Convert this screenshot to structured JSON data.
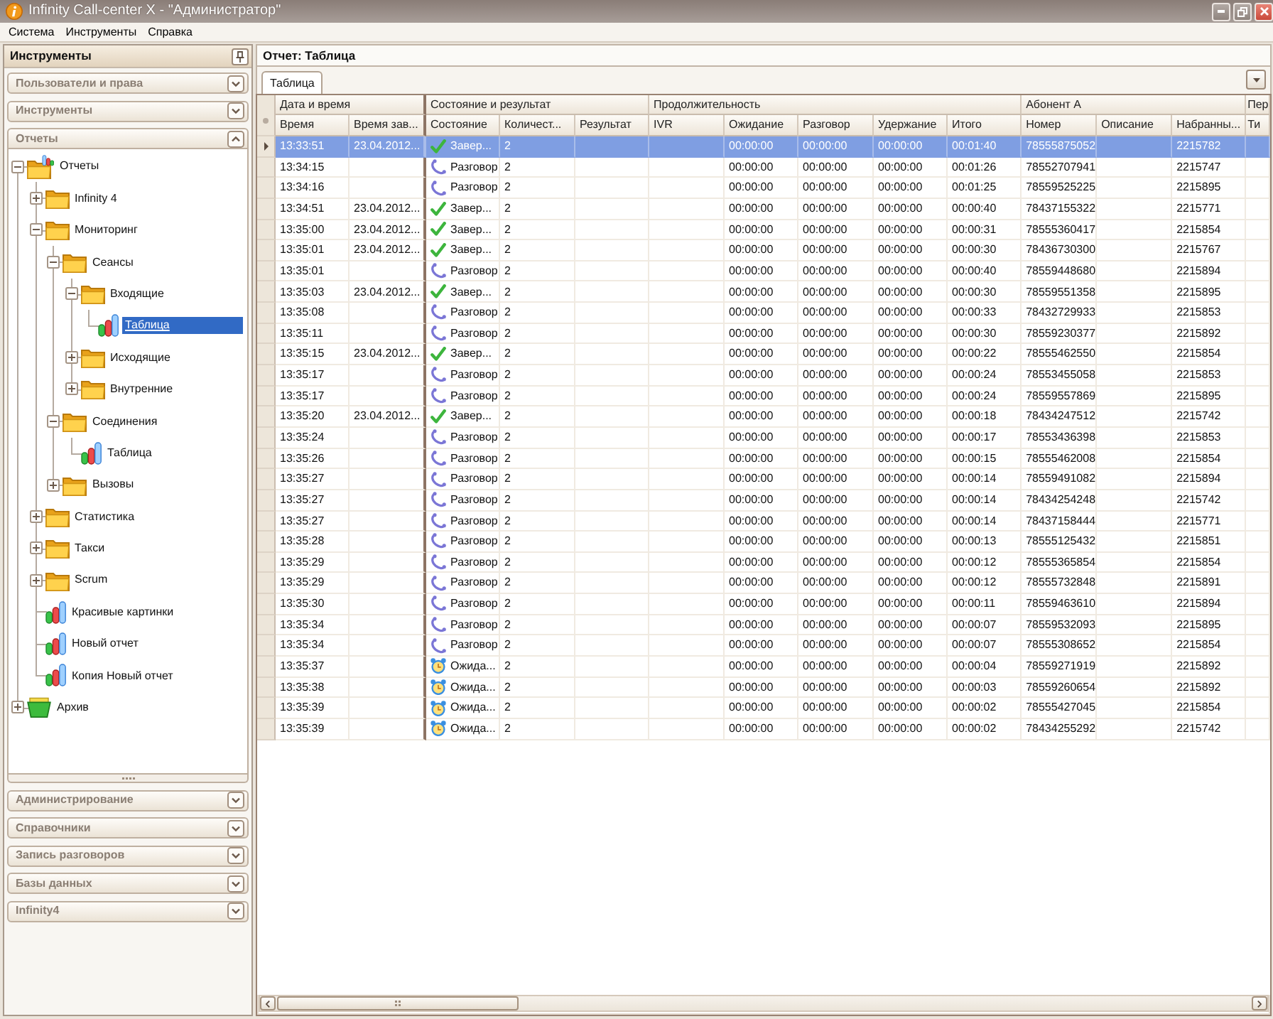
{
  "window": {
    "title": "Infinity Call-center X - \"Администратор\""
  },
  "menu": [
    "Система",
    "Инструменты",
    "Справка"
  ],
  "sidebar": {
    "title": "Инструменты",
    "sections": [
      {
        "title": "Пользователи и права",
        "expanded": false
      },
      {
        "title": "Инструменты",
        "expanded": false
      },
      {
        "title": "Отчеты",
        "expanded": true,
        "tree": [
          {
            "label": "Отчеты",
            "kind": "collection",
            "expanded": true,
            "selected": false,
            "children": [
              {
                "label": "Infinity 4",
                "kind": "folder",
                "expanded": false,
                "selected": false
              },
              {
                "label": "Мониторинг",
                "kind": "folder",
                "expanded": true,
                "selected": false,
                "children": [
                  {
                    "label": "Сеансы",
                    "kind": "folder",
                    "expanded": true,
                    "selected": false,
                    "children": [
                      {
                        "label": "Входящие",
                        "kind": "folder",
                        "expanded": true,
                        "selected": false,
                        "children": [
                          {
                            "label": "Таблица",
                            "kind": "report",
                            "selected": true
                          }
                        ]
                      },
                      {
                        "label": "Исходящие",
                        "kind": "folder",
                        "expanded": false,
                        "selected": false
                      },
                      {
                        "label": "Внутренние",
                        "kind": "folder",
                        "expanded": false,
                        "selected": false
                      }
                    ]
                  },
                  {
                    "label": "Соединения",
                    "kind": "folder",
                    "expanded": true,
                    "selected": false,
                    "children": [
                      {
                        "label": "Таблица",
                        "kind": "report",
                        "selected": false
                      }
                    ]
                  },
                  {
                    "label": "Вызовы",
                    "kind": "folder",
                    "expanded": false,
                    "selected": false
                  }
                ]
              },
              {
                "label": "Статистика",
                "kind": "folder",
                "expanded": false,
                "selected": false
              },
              {
                "label": "Такси",
                "kind": "folder",
                "expanded": false,
                "selected": false
              },
              {
                "label": "Scrum",
                "kind": "folder",
                "expanded": false,
                "selected": false
              },
              {
                "label": "Красивые картинки",
                "kind": "report",
                "selected": false
              },
              {
                "label": "Новый отчет",
                "kind": "report",
                "selected": false
              },
              {
                "label": "Копия Новый отчет",
                "kind": "report",
                "selected": false
              }
            ]
          },
          {
            "label": "Архив",
            "kind": "archive",
            "expanded": false,
            "selected": false
          }
        ]
      },
      {
        "title": "Администрирование",
        "expanded": false
      },
      {
        "title": "Справочники",
        "expanded": false
      },
      {
        "title": "Запись разговоров",
        "expanded": false
      },
      {
        "title": "Базы данных",
        "expanded": false
      },
      {
        "title": "Infinity4",
        "expanded": false
      }
    ]
  },
  "report": {
    "title": "Отчет: Таблица",
    "tabs": [
      {
        "label": "Таблица",
        "selected": true
      }
    ],
    "table": {
      "groups": [
        {
          "title": "Дата и время",
          "frozen": true,
          "columns": [
            "Время",
            "Время зав..."
          ]
        },
        {
          "title": "Состояние и результат",
          "frozen": false,
          "columns": [
            "Состояние",
            "Количест...",
            "Результат"
          ]
        },
        {
          "title": "Продолжительность",
          "frozen": false,
          "columns": [
            "IVR",
            "Ожидание",
            "Разговор",
            "Удержание",
            "Итого"
          ]
        },
        {
          "title": "Абонент А",
          "frozen": false,
          "columns": [
            "Номер",
            "Описание",
            "Набранны..."
          ]
        },
        {
          "title": "Пер",
          "frozen": false,
          "columns": [
            "Ти"
          ]
        }
      ],
      "rows": [
        {
          "selected": true,
          "time": "13:33:51",
          "end_time": "23.04.2012...",
          "state": {
            "kind": "done",
            "label": "Завер..."
          },
          "count": "2",
          "wait": "00:00:00",
          "talk": "00:00:00",
          "hold": "00:00:00",
          "total": "00:01:40",
          "number": "78555875052",
          "dialed": "2215782"
        },
        {
          "selected": false,
          "time": "13:34:15",
          "state": {
            "kind": "call",
            "label": "Разговор"
          },
          "count": "2",
          "wait": "00:00:00",
          "talk": "00:00:00",
          "hold": "00:00:00",
          "total": "00:01:26",
          "number": "78552707941",
          "dialed": "2215747"
        },
        {
          "selected": false,
          "time": "13:34:16",
          "state": {
            "kind": "call",
            "label": "Разговор"
          },
          "count": "2",
          "wait": "00:00:00",
          "talk": "00:00:00",
          "hold": "00:00:00",
          "total": "00:01:25",
          "number": "78559525225",
          "dialed": "2215895"
        },
        {
          "selected": false,
          "time": "13:34:51",
          "end_time": "23.04.2012...",
          "state": {
            "kind": "done",
            "label": "Завер..."
          },
          "count": "2",
          "wait": "00:00:00",
          "talk": "00:00:00",
          "hold": "00:00:00",
          "total": "00:00:40",
          "number": "78437155322",
          "dialed": "2215771"
        },
        {
          "selected": false,
          "time": "13:35:00",
          "end_time": "23.04.2012...",
          "state": {
            "kind": "done",
            "label": "Завер..."
          },
          "count": "2",
          "wait": "00:00:00",
          "talk": "00:00:00",
          "hold": "00:00:00",
          "total": "00:00:31",
          "number": "78555360417",
          "dialed": "2215854"
        },
        {
          "selected": false,
          "time": "13:35:01",
          "end_time": "23.04.2012...",
          "state": {
            "kind": "done",
            "label": "Завер..."
          },
          "count": "2",
          "wait": "00:00:00",
          "talk": "00:00:00",
          "hold": "00:00:00",
          "total": "00:00:30",
          "number": "78436730300",
          "dialed": "2215767"
        },
        {
          "selected": false,
          "time": "13:35:01",
          "state": {
            "kind": "call",
            "label": "Разговор"
          },
          "count": "2",
          "wait": "00:00:00",
          "talk": "00:00:00",
          "hold": "00:00:00",
          "total": "00:00:40",
          "number": "78559448680",
          "dialed": "2215894"
        },
        {
          "selected": false,
          "time": "13:35:03",
          "end_time": "23.04.2012...",
          "state": {
            "kind": "done",
            "label": "Завер..."
          },
          "count": "2",
          "wait": "00:00:00",
          "talk": "00:00:00",
          "hold": "00:00:00",
          "total": "00:00:30",
          "number": "78559551358",
          "dialed": "2215895"
        },
        {
          "selected": false,
          "time": "13:35:08",
          "state": {
            "kind": "call",
            "label": "Разговор"
          },
          "count": "2",
          "wait": "00:00:00",
          "talk": "00:00:00",
          "hold": "00:00:00",
          "total": "00:00:33",
          "number": "78432729933",
          "dialed": "2215853"
        },
        {
          "selected": false,
          "time": "13:35:11",
          "state": {
            "kind": "call",
            "label": "Разговор"
          },
          "count": "2",
          "wait": "00:00:00",
          "talk": "00:00:00",
          "hold": "00:00:00",
          "total": "00:00:30",
          "number": "78559230377",
          "dialed": "2215892"
        },
        {
          "selected": false,
          "time": "13:35:15",
          "end_time": "23.04.2012...",
          "state": {
            "kind": "done",
            "label": "Завер..."
          },
          "count": "2",
          "wait": "00:00:00",
          "talk": "00:00:00",
          "hold": "00:00:00",
          "total": "00:00:22",
          "number": "78555462550",
          "dialed": "2215854"
        },
        {
          "selected": false,
          "time": "13:35:17",
          "state": {
            "kind": "call",
            "label": "Разговор"
          },
          "count": "2",
          "wait": "00:00:00",
          "talk": "00:00:00",
          "hold": "00:00:00",
          "total": "00:00:24",
          "number": "78553455058",
          "dialed": "2215853"
        },
        {
          "selected": false,
          "time": "13:35:17",
          "state": {
            "kind": "call",
            "label": "Разговор"
          },
          "count": "2",
          "wait": "00:00:00",
          "talk": "00:00:00",
          "hold": "00:00:00",
          "total": "00:00:24",
          "number": "78559557869",
          "dialed": "2215895"
        },
        {
          "selected": false,
          "time": "13:35:20",
          "end_time": "23.04.2012...",
          "state": {
            "kind": "done",
            "label": "Завер..."
          },
          "count": "2",
          "wait": "00:00:00",
          "talk": "00:00:00",
          "hold": "00:00:00",
          "total": "00:00:18",
          "number": "78434247512",
          "dialed": "2215742"
        },
        {
          "selected": false,
          "time": "13:35:24",
          "state": {
            "kind": "call",
            "label": "Разговор"
          },
          "count": "2",
          "wait": "00:00:00",
          "talk": "00:00:00",
          "hold": "00:00:00",
          "total": "00:00:17",
          "number": "78553436398",
          "dialed": "2215853"
        },
        {
          "selected": false,
          "time": "13:35:26",
          "state": {
            "kind": "call",
            "label": "Разговор"
          },
          "count": "2",
          "wait": "00:00:00",
          "talk": "00:00:00",
          "hold": "00:00:00",
          "total": "00:00:15",
          "number": "78555462008",
          "dialed": "2215854"
        },
        {
          "selected": false,
          "time": "13:35:27",
          "state": {
            "kind": "call",
            "label": "Разговор"
          },
          "count": "2",
          "wait": "00:00:00",
          "talk": "00:00:00",
          "hold": "00:00:00",
          "total": "00:00:14",
          "number": "78559491082",
          "dialed": "2215894"
        },
        {
          "selected": false,
          "time": "13:35:27",
          "state": {
            "kind": "call",
            "label": "Разговор"
          },
          "count": "2",
          "wait": "00:00:00",
          "talk": "00:00:00",
          "hold": "00:00:00",
          "total": "00:00:14",
          "number": "78434254248",
          "dialed": "2215742"
        },
        {
          "selected": false,
          "time": "13:35:27",
          "state": {
            "kind": "call",
            "label": "Разговор"
          },
          "count": "2",
          "wait": "00:00:00",
          "talk": "00:00:00",
          "hold": "00:00:00",
          "total": "00:00:14",
          "number": "78437158444",
          "dialed": "2215771"
        },
        {
          "selected": false,
          "time": "13:35:28",
          "state": {
            "kind": "call",
            "label": "Разговор"
          },
          "count": "2",
          "wait": "00:00:00",
          "talk": "00:00:00",
          "hold": "00:00:00",
          "total": "00:00:13",
          "number": "78555125432",
          "dialed": "2215851"
        },
        {
          "selected": false,
          "time": "13:35:29",
          "state": {
            "kind": "call",
            "label": "Разговор"
          },
          "count": "2",
          "wait": "00:00:00",
          "talk": "00:00:00",
          "hold": "00:00:00",
          "total": "00:00:12",
          "number": "78555365854",
          "dialed": "2215854"
        },
        {
          "selected": false,
          "time": "13:35:29",
          "state": {
            "kind": "call",
            "label": "Разговор"
          },
          "count": "2",
          "wait": "00:00:00",
          "talk": "00:00:00",
          "hold": "00:00:00",
          "total": "00:00:12",
          "number": "78555732848",
          "dialed": "2215891"
        },
        {
          "selected": false,
          "time": "13:35:30",
          "state": {
            "kind": "call",
            "label": "Разговор"
          },
          "count": "2",
          "wait": "00:00:00",
          "talk": "00:00:00",
          "hold": "00:00:00",
          "total": "00:00:11",
          "number": "78559463610",
          "dialed": "2215894"
        },
        {
          "selected": false,
          "time": "13:35:34",
          "state": {
            "kind": "call",
            "label": "Разговор"
          },
          "count": "2",
          "wait": "00:00:00",
          "talk": "00:00:00",
          "hold": "00:00:00",
          "total": "00:00:07",
          "number": "78559532093",
          "dialed": "2215895"
        },
        {
          "selected": false,
          "time": "13:35:34",
          "state": {
            "kind": "call",
            "label": "Разговор"
          },
          "count": "2",
          "wait": "00:00:00",
          "talk": "00:00:00",
          "hold": "00:00:00",
          "total": "00:00:07",
          "number": "78555308652",
          "dialed": "2215854"
        },
        {
          "selected": false,
          "time": "13:35:37",
          "state": {
            "kind": "wait",
            "label": "Ожида..."
          },
          "count": "2",
          "wait": "00:00:00",
          "talk": "00:00:00",
          "hold": "00:00:00",
          "total": "00:00:04",
          "number": "78559271919",
          "dialed": "2215892"
        },
        {
          "selected": false,
          "time": "13:35:38",
          "state": {
            "kind": "wait",
            "label": "Ожида..."
          },
          "count": "2",
          "wait": "00:00:00",
          "talk": "00:00:00",
          "hold": "00:00:00",
          "total": "00:00:03",
          "number": "78559260654",
          "dialed": "2215892"
        },
        {
          "selected": false,
          "time": "13:35:39",
          "state": {
            "kind": "wait",
            "label": "Ожида..."
          },
          "count": "2",
          "wait": "00:00:00",
          "talk": "00:00:00",
          "hold": "00:00:00",
          "total": "00:00:02",
          "number": "78555427045",
          "dialed": "2215854"
        },
        {
          "selected": false,
          "time": "13:35:39",
          "state": {
            "kind": "wait",
            "label": "Ожида..."
          },
          "count": "2",
          "wait": "00:00:00",
          "talk": "00:00:00",
          "hold": "00:00:00",
          "total": "00:00:02",
          "number": "78434255292",
          "dialed": "2215742"
        }
      ]
    }
  }
}
